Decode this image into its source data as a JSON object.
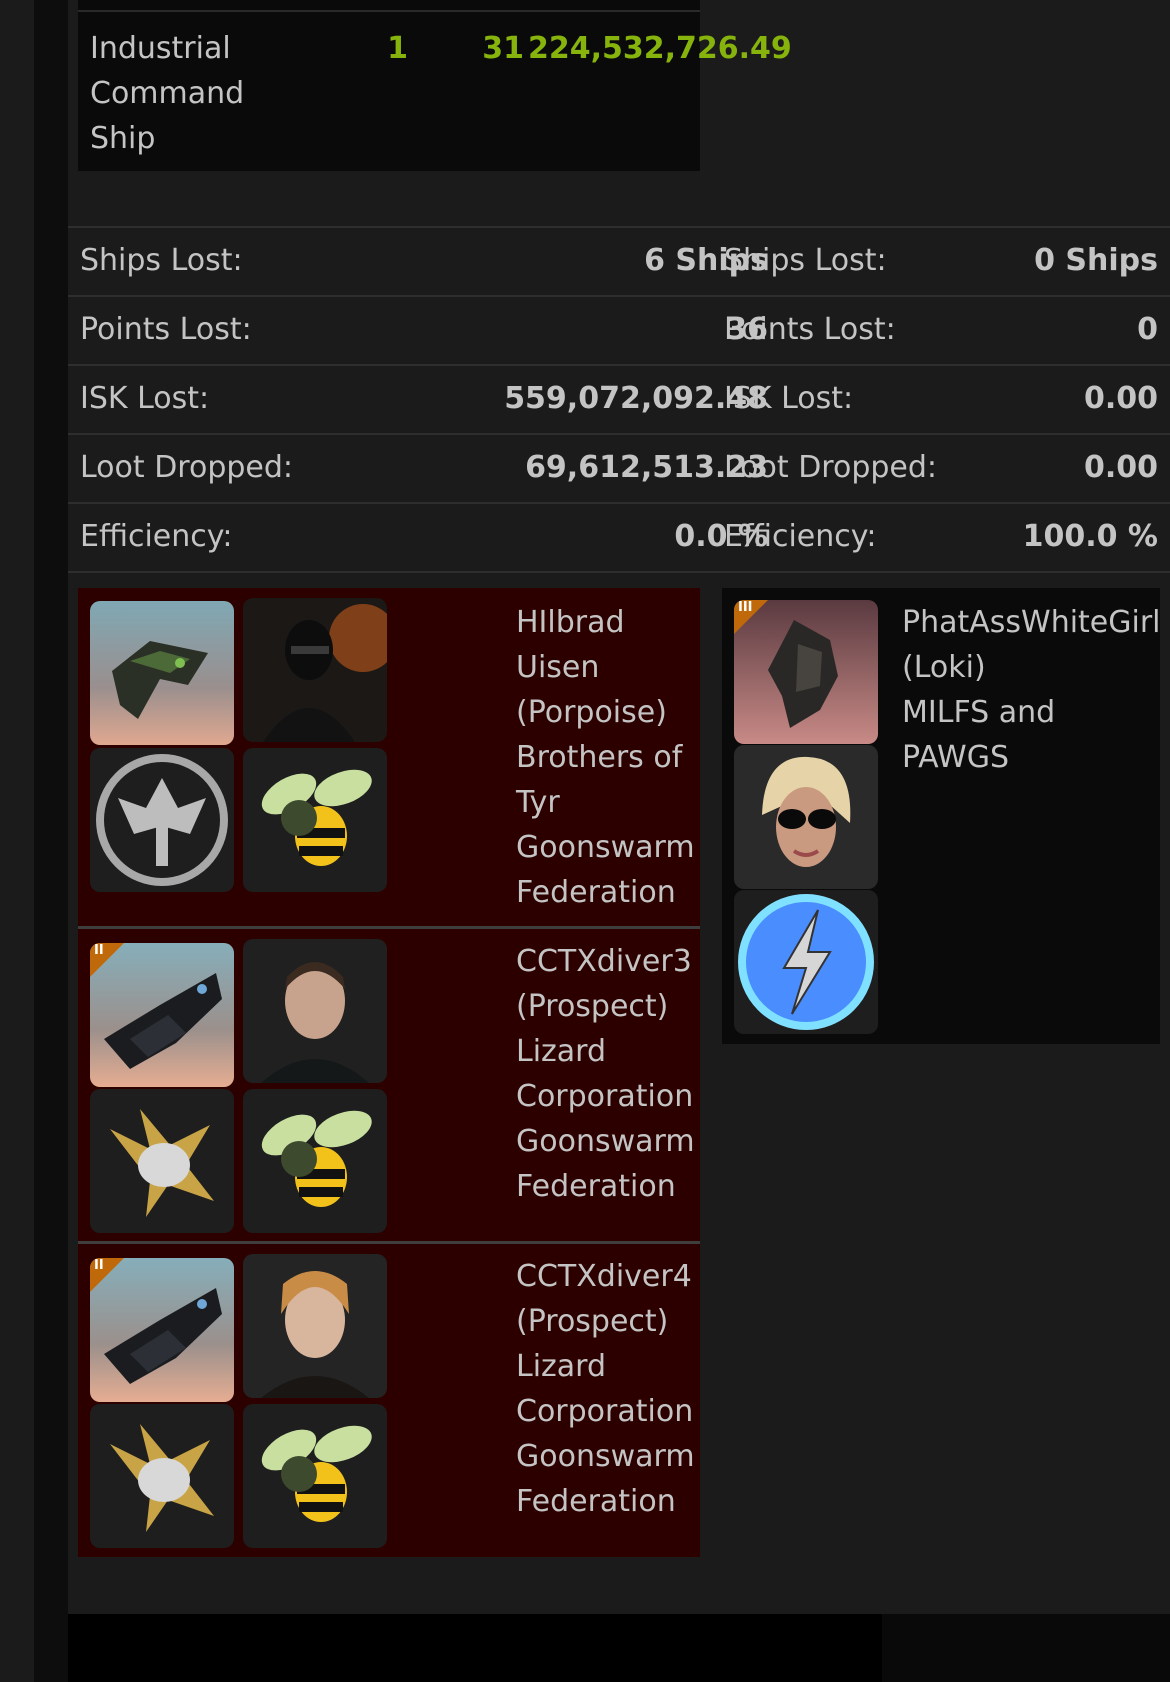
{
  "ship_class_row": {
    "name_lines": [
      "Industrial",
      "Command",
      "Ship"
    ],
    "count": "1",
    "points": "31",
    "isk": "224,532,726.49"
  },
  "stats": [
    {
      "label": "Ships Lost:",
      "left": "6 Ships",
      "right_label": "Ships Lost:",
      "right": "0 Ships"
    },
    {
      "label": "Points Lost:",
      "left": "36",
      "right_label": "Points Lost:",
      "right": "0"
    },
    {
      "label": "ISK Lost:",
      "left": "559,072,092.48",
      "right_label": "ISK Lost:",
      "right": "0.00"
    },
    {
      "label": "Loot Dropped:",
      "left": "69,612,513.23",
      "right_label": "Loot Dropped:",
      "right": "0.00"
    },
    {
      "label": "Efficiency:",
      "left": "0.0 %",
      "right_label": "Efficiency:",
      "right": "100.0 %"
    }
  ],
  "losers": [
    {
      "lines": [
        "HIlbrad",
        "Uisen",
        "(Porpoise)",
        "Brothers of",
        "Tyr",
        "Goonswarm",
        "Federation"
      ],
      "tech": "",
      "ship_icon": "porpoise-ship-icon",
      "portrait_icon": "masked-pilot-portrait",
      "corp_icon": "eagle-emblem-icon",
      "alliance_icon": "bee-logo-icon"
    },
    {
      "lines": [
        "CCTXdiver3",
        "(Prospect)",
        "Lizard",
        "Corporation",
        "Goonswarm",
        "Federation"
      ],
      "tech": "II",
      "ship_icon": "prospect-ship-icon",
      "portrait_icon": "male-pilot-portrait",
      "corp_icon": "golden-bird-emblem-icon",
      "alliance_icon": "bee-logo-icon"
    },
    {
      "lines": [
        "CCTXdiver4",
        "(Prospect)",
        "Lizard",
        "Corporation",
        "Goonswarm",
        "Federation"
      ],
      "tech": "II",
      "ship_icon": "prospect-ship-icon",
      "portrait_icon": "blond-pilot-portrait",
      "corp_icon": "golden-bird-emblem-icon",
      "alliance_icon": "bee-logo-icon"
    }
  ],
  "winner": {
    "lines": [
      "PhatAssWhiteGirl",
      "(Loki)",
      "MILFS and",
      "PAWGS"
    ],
    "tech": "III",
    "ship_icon": "loki-ship-icon",
    "portrait_icon": "sunglasses-pilot-portrait",
    "corp_icon": "lightning-emblem-icon"
  },
  "colors": {
    "loss_card_bg": "#2d0000",
    "value_green": "#87b30d",
    "tech_badge": "#c0690a",
    "panel_bg": "#1b1b1b"
  }
}
